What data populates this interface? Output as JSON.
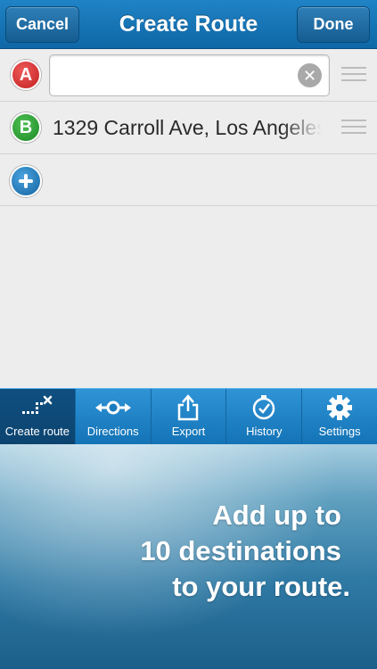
{
  "navbar": {
    "title": "Create Route",
    "cancel_label": "Cancel",
    "done_label": "Done"
  },
  "route": {
    "stops": [
      {
        "letter": "A",
        "color": "#d62a2a",
        "value": "",
        "placeholder": ""
      },
      {
        "letter": "B",
        "color": "#2a9a30",
        "value": "1329 Carroll Ave, Los Angeles"
      }
    ]
  },
  "tabs": [
    {
      "label": "Create route",
      "icon": "create-route-icon",
      "active": true
    },
    {
      "label": "Directions",
      "icon": "directions-icon",
      "active": false
    },
    {
      "label": "Export",
      "icon": "export-icon",
      "active": false
    },
    {
      "label": "History",
      "icon": "history-icon",
      "active": false
    },
    {
      "label": "Settings",
      "icon": "gear-icon",
      "active": false
    }
  ],
  "promo": {
    "line1": "Add up to",
    "line2": "10 destinations",
    "line3": "to your route."
  },
  "colors": {
    "navbar": "#1673b3",
    "tabbar": "#1f85c8",
    "active_tab": "#0e4a78"
  }
}
